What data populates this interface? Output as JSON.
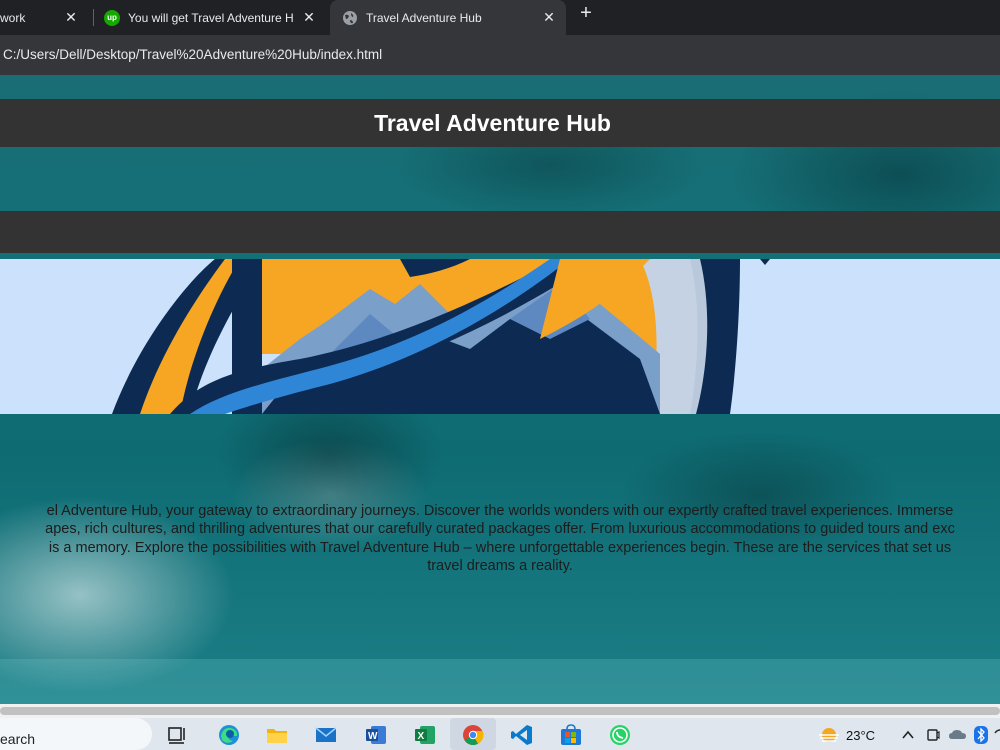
{
  "browser": {
    "tabs": [
      {
        "label": "work",
        "close": "✕"
      },
      {
        "label": "You will get Travel Adventure H",
        "favicon": "up",
        "close": "✕"
      },
      {
        "label": "Travel Adventure Hub",
        "close": "✕"
      }
    ],
    "new_tab": "+",
    "url": "C:/Users/Dell/Desktop/Travel%20Adventure%20Hub/index.html"
  },
  "page": {
    "title": "Travel Adventure Hub",
    "intro_lines": [
      "el Adventure Hub, your gateway to extraordinary journeys. Discover the worlds wonders with our expertly crafted travel experiences. Immerse",
      "apes, rich cultures, and thrilling adventures that our carefully curated packages offer. From luxurious accommodations to guided tours and exc",
      "is a memory. Explore the possibilities with Travel Adventure Hub – where unforgettable experiences begin. These are the services that set us",
      "travel dreams a reality."
    ]
  },
  "taskbar": {
    "search_text": "earch",
    "apps": [
      "task-view",
      "edge",
      "file-explorer",
      "mail",
      "word",
      "excel",
      "chrome",
      "vscode",
      "microsoft-store",
      "whatsapp"
    ],
    "weather": {
      "temp": "23°C",
      "icon": "sun-haze"
    }
  },
  "colors": {
    "header_bar": "#333333",
    "banner_bg": "#cce1fb",
    "logo_navy": "#0d2a52",
    "logo_orange": "#f6a623",
    "logo_blue": "#2f86d6"
  }
}
